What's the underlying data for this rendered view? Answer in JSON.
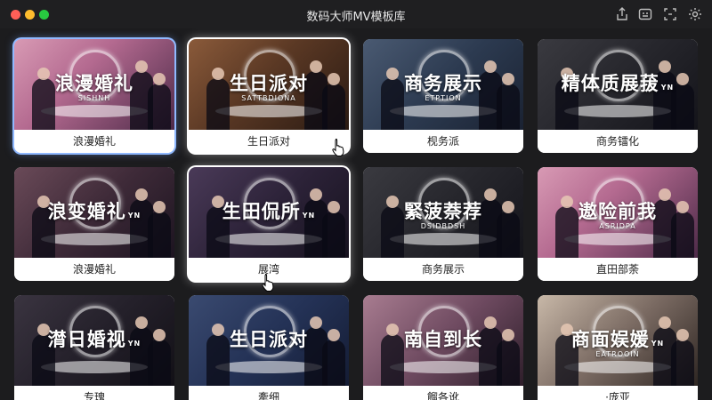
{
  "window": {
    "title": "数码大师MV模板库",
    "toolbar_icons": [
      "share-icon",
      "caption-icon",
      "fullscreen-icon",
      "settings-icon"
    ]
  },
  "cards": [
    {
      "title": "浪漫婚礼",
      "subtitle": "SISHNH",
      "caption": "浪漫婚礼",
      "theme": "wedding-pink",
      "state": "selected"
    },
    {
      "title": "生日派对",
      "subtitle": "SATTBDIONA",
      "caption": "生日派对",
      "theme": "party-warm",
      "state": "hover"
    },
    {
      "title": "商务展示",
      "subtitle": "ETPTION",
      "caption": "枧务派",
      "theme": "business-blue",
      "state": "normal"
    },
    {
      "title": "精体质展菝",
      "subtitle": "",
      "badge": "YN",
      "caption": "商务镭化",
      "theme": "business-dark",
      "state": "normal"
    },
    {
      "title": "浪变婚礼",
      "subtitle": "",
      "badge": "YN",
      "caption": "浪漫婚礼",
      "theme": "wedding-dusk",
      "state": "normal"
    },
    {
      "title": "生田侃所",
      "subtitle": "",
      "badge": "YN",
      "caption": "展湾",
      "theme": "party-purple",
      "state": "hover"
    },
    {
      "title": "緊菠萘荐",
      "subtitle": "DSIDBDSH",
      "caption": "商务展示",
      "theme": "business-dark",
      "state": "normal"
    },
    {
      "title": "遨险前我",
      "subtitle": "ASRIDPA",
      "caption": "直田部荼",
      "theme": "wedding-pink",
      "state": "normal"
    },
    {
      "title": "潸日婚视",
      "subtitle": "",
      "badge": "YN",
      "caption": "专瑰",
      "theme": "party-dark",
      "state": "normal"
    },
    {
      "title": "生日派对",
      "subtitle": "",
      "caption": "牽细",
      "theme": "party-blue",
      "state": "normal"
    },
    {
      "title": "南自到长",
      "subtitle": "",
      "caption": "餾各讹",
      "theme": "wedding-mauve",
      "state": "normal"
    },
    {
      "title": "商面娱媛",
      "subtitle": "EATROOIN",
      "badge": "YN",
      "caption": "·庞亚",
      "theme": "business-light",
      "state": "normal"
    }
  ]
}
